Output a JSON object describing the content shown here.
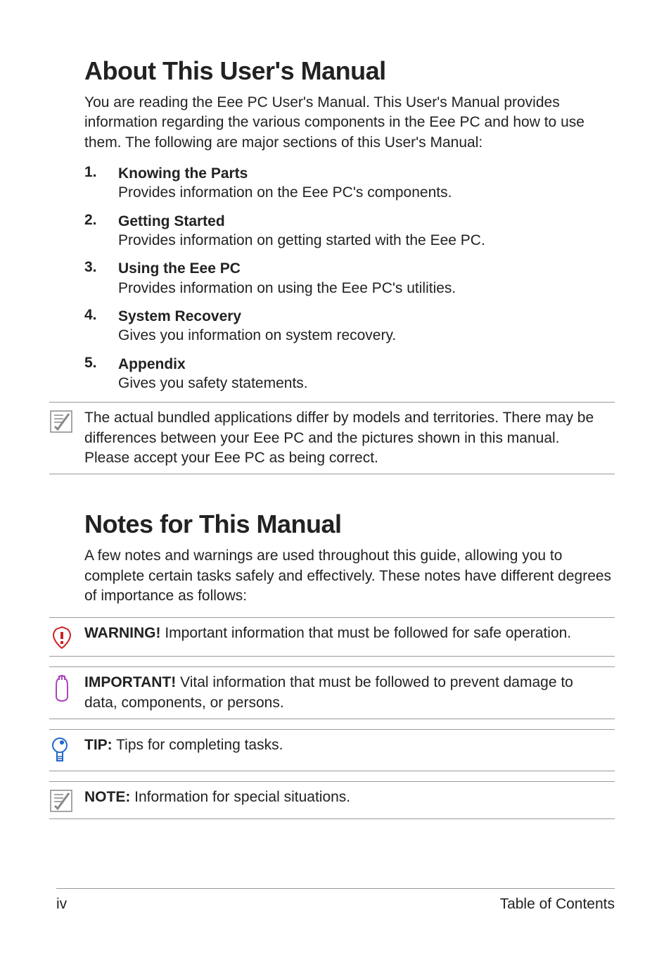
{
  "heading1": "About This User's Manual",
  "intro1": "You are reading the Eee PC User's Manual. This User's Manual provides information regarding the various components in the Eee PC and how to use them. The following are major sections of this User's Manual:",
  "items": [
    {
      "num": "1.",
      "title": "Knowing the Parts",
      "desc": "Provides information on the Eee PC's components."
    },
    {
      "num": "2.",
      "title": "Getting Started",
      "desc": "Provides information on getting started with the Eee PC."
    },
    {
      "num": "3.",
      "title": "Using the Eee PC",
      "desc": "Provides information on using the Eee PC's utilities."
    },
    {
      "num": "4.",
      "title": "System Recovery",
      "desc": "Gives you information on system recovery."
    },
    {
      "num": "5.",
      "title": "Appendix",
      "desc": "Gives you safety statements."
    }
  ],
  "note1": "The actual bundled applications differ by models and territories. There may be differences between your Eee PC and the pictures shown in this manual. Please accept your Eee PC as being correct.",
  "heading2": "Notes for This Manual",
  "intro2": "A few notes and warnings are used throughout this guide, allowing you to complete certain tasks safely and effectively. These notes have different degrees of importance as follows:",
  "warning_label": "WARNING!",
  "warning_text": " Important information that must be followed for safe operation.",
  "important_label": "IMPORTANT!",
  "important_text": " Vital information that must be followed to prevent damage to data, components, or persons.",
  "tip_label": "TIP:",
  "tip_text": " Tips for completing tasks.",
  "note_label": "NOTE:",
  "note_text": "  Information for special situations.",
  "page_num": "iv",
  "footer_label": "Table of Contents"
}
